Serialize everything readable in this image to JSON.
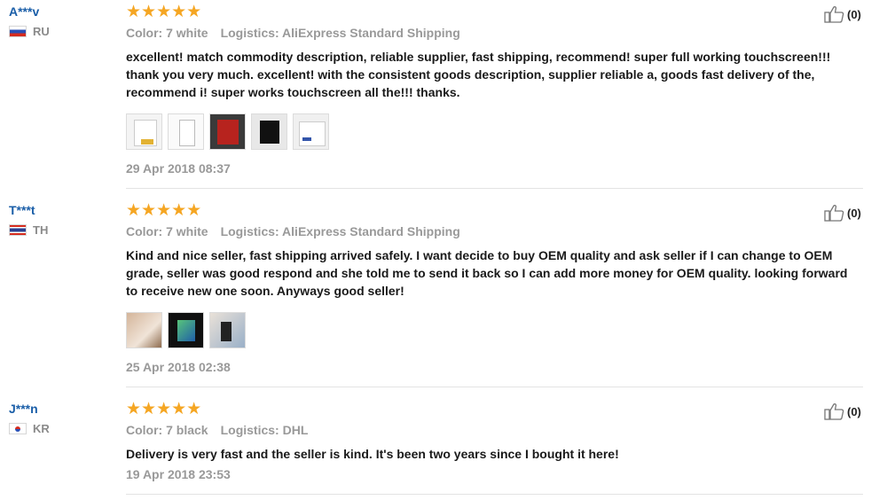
{
  "reviews": [
    {
      "user": "A***v",
      "country": "RU",
      "stars": "★★★★★",
      "color_label": "Color: 7 white",
      "logistics_label": "Logistics: AliExpress Standard Shipping",
      "text": "excellent! match commodity description, reliable supplier, fast shipping, recommend! super full working touchscreen!!! thank you very much. excellent! with the consistent goods description, supplier reliable a, goods fast delivery of the, recommend i! super works touchscreen all the!!! thanks.",
      "date": "29 Apr 2018 08:37",
      "likes": "(0)",
      "photo_count": 5
    },
    {
      "user": "T***t",
      "country": "TH",
      "stars": "★★★★★",
      "color_label": "Color: 7 white",
      "logistics_label": "Logistics: AliExpress Standard Shipping",
      "text": "Kind and nice seller, fast shipping arrived safely. I want decide to buy OEM quality and ask seller if I can change to OEM grade, seller was good respond and she told me to send it back so I can add more money for OEM quality. looking forward to receive new one soon. Anyways good seller!",
      "date": "25 Apr 2018 02:38",
      "likes": "(0)",
      "photo_count": 3
    },
    {
      "user": "J***n",
      "country": "KR",
      "stars": "★★★★★",
      "color_label": "Color: 7 black",
      "logistics_label": "Logistics: DHL",
      "text": "Delivery is very fast and the seller is kind. It's been two years since I bought it here!",
      "date": "19 Apr 2018 23:53",
      "likes": "(0)",
      "photo_count": 0
    }
  ],
  "icons": {
    "rating": "star-icon",
    "helpful": "thumbs-up-icon"
  },
  "colors": {
    "user_link": "#1a5ea8",
    "star": "#f5a623",
    "meta": "#999999"
  }
}
